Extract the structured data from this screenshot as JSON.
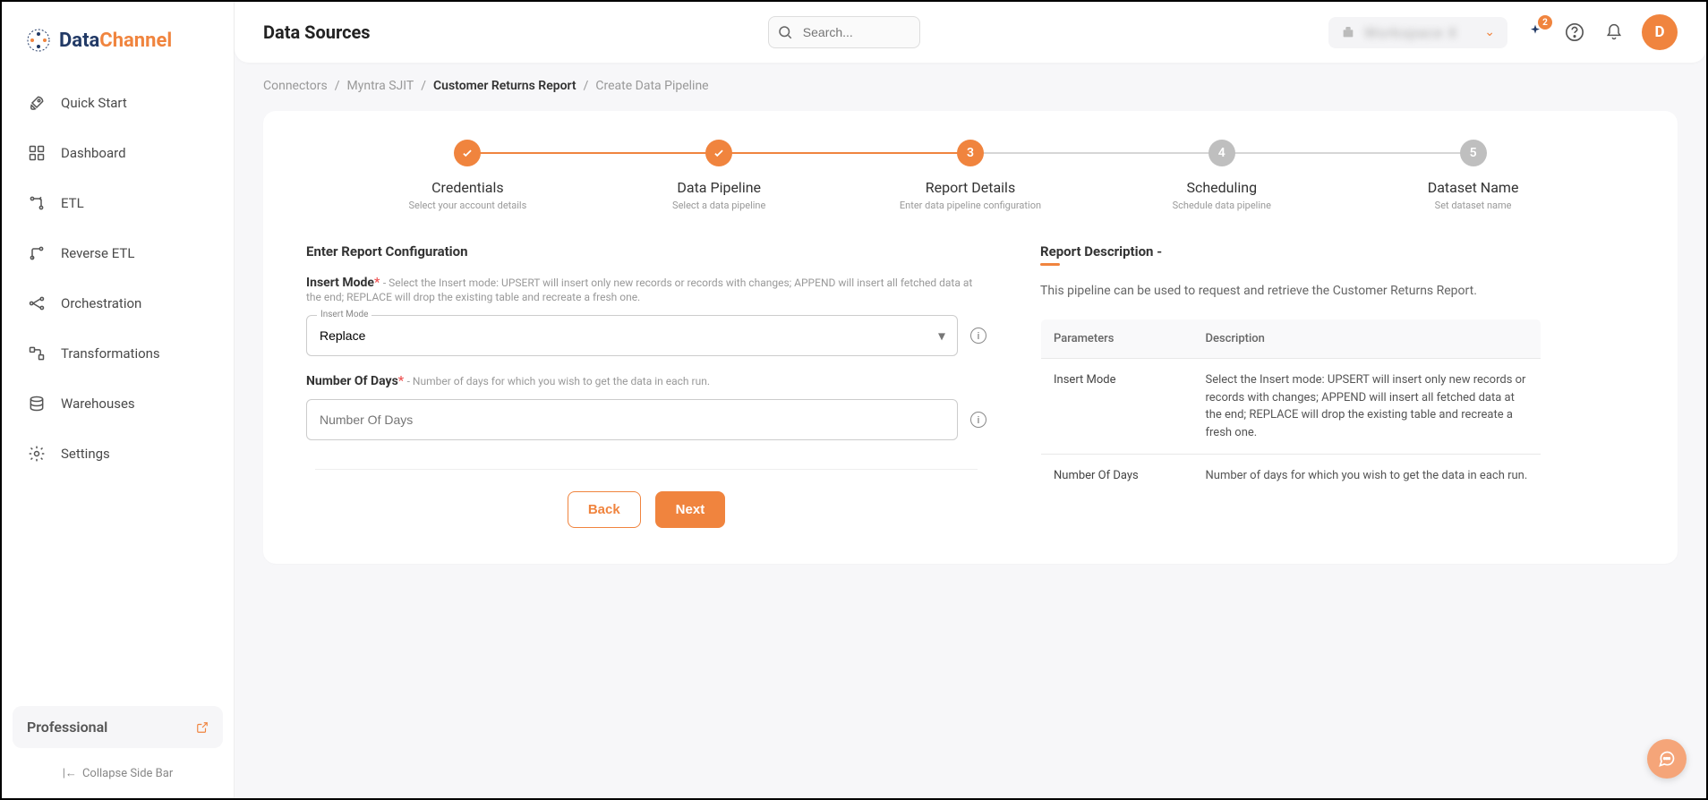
{
  "logo": {
    "part1": "Data",
    "part2": "Channel"
  },
  "sidebar": {
    "items": [
      {
        "label": "Quick Start",
        "icon": "rocket-icon"
      },
      {
        "label": "Dashboard",
        "icon": "grid-icon"
      },
      {
        "label": "ETL",
        "icon": "etl-icon"
      },
      {
        "label": "Reverse ETL",
        "icon": "reverse-etl-icon"
      },
      {
        "label": "Orchestration",
        "icon": "orchestration-icon"
      },
      {
        "label": "Transformations",
        "icon": "transformations-icon"
      },
      {
        "label": "Warehouses",
        "icon": "database-icon"
      },
      {
        "label": "Settings",
        "icon": "gear-icon"
      }
    ],
    "plan": "Professional",
    "collapse": "Collapse Side Bar"
  },
  "header": {
    "title": "Data Sources",
    "searchPlaceholder": "Search...",
    "badgeCount": "2",
    "avatarLetter": "D"
  },
  "breadcrumb": {
    "items": [
      "Connectors",
      "Myntra SJIT",
      "Customer Returns Report",
      "Create Data Pipeline"
    ],
    "currentIndex": 2
  },
  "steps": [
    {
      "title": "Credentials",
      "sub": "Select your account details",
      "state": "done"
    },
    {
      "title": "Data Pipeline",
      "sub": "Select a data pipeline",
      "state": "done"
    },
    {
      "title": "Report Details",
      "sub": "Enter data pipeline configuration",
      "state": "active",
      "num": "3"
    },
    {
      "title": "Scheduling",
      "sub": "Schedule data pipeline",
      "state": "pending",
      "num": "4"
    },
    {
      "title": "Dataset Name",
      "sub": "Set dataset name",
      "state": "pending",
      "num": "5"
    }
  ],
  "form": {
    "sectionTitle": "Enter Report Configuration",
    "insertMode": {
      "label": "Insert Mode",
      "help": "- Select the Insert mode: UPSERT will insert only new records or records with changes; APPEND will insert all fetched data at the end; REPLACE will drop the existing table and recreate a fresh one.",
      "floatLabel": "Insert Mode",
      "value": "Replace"
    },
    "numberOfDays": {
      "label": "Number Of Days",
      "help": "- Number of days for which you wish to get the data in each run.",
      "placeholder": "Number Of Days",
      "value": ""
    },
    "backLabel": "Back",
    "nextLabel": "Next"
  },
  "description": {
    "title": "Report Description -",
    "text": "This pipeline can be used to request and retrieve the Customer Returns Report.",
    "tableHeaders": [
      "Parameters",
      "Description"
    ],
    "rows": [
      {
        "param": "Insert Mode",
        "desc": "Select the Insert mode: UPSERT will insert only new records or records with changes; APPEND will insert all fetched data at the end; REPLACE will drop the existing table and recreate a fresh one."
      },
      {
        "param": "Number Of Days",
        "desc": "Number of days for which you wish to get the data in each run."
      }
    ]
  }
}
